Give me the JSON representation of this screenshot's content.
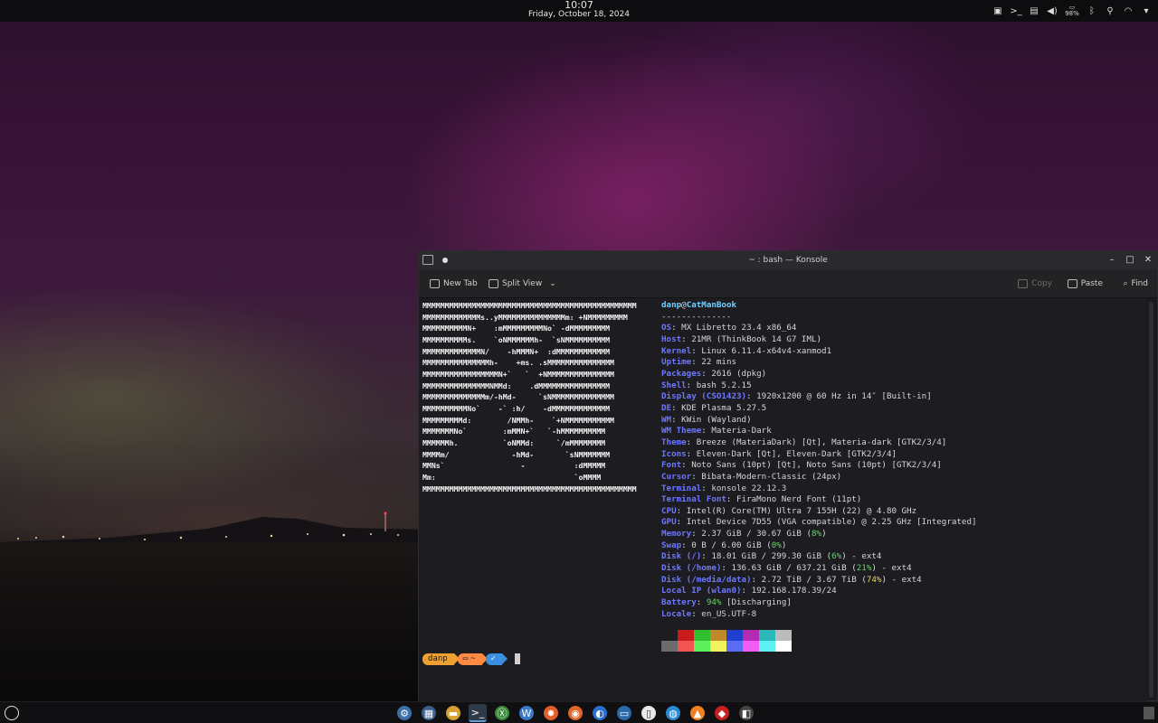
{
  "topbar": {
    "time": "10:07",
    "date": "Friday, October 18, 2024",
    "battery_label": "98%",
    "tray_icons": [
      "package-icon",
      "terminal-icon",
      "clipboard-icon",
      "volume-icon",
      "battery-icon",
      "bluetooth-icon",
      "usb-icon",
      "wifi-icon",
      "menu-arrow-icon"
    ]
  },
  "window": {
    "title": "~ : bash — Konsole"
  },
  "toolbar": {
    "new_tab": "New Tab",
    "split_view": "Split View",
    "copy": "Copy",
    "paste": "Paste",
    "find": "Find"
  },
  "terminal": {
    "ascii": "MMMMMMMMMMMMMMMMMMMMMMMMMMMMMMMMMMMMMMMMMMMMMMMM\nMMMMMMMMMMMMMs..yMMMMMMMMMMMMMMMm: +NMMMMMMMMM\nMMMMMMMMMMN+    :mMMMMMMMMMNo` -dMMMMMMMMM\nMMMMMMMMMMs.    `oNMMMMMMh-  `sNMMMMMMMMMM\nMMMMMMMMMMMMMN/    -hMMMN+  :dMMMMMMMMMMMM\nMMMMMMMMMMMMMMMh-    +ms. .sMMMMMMMMMMMMMMM\nMMMMMMMMMMMMMMMMMN+`   `  +NMMMMMMMMMMMMMMM\nMMMMMMMMMMMMMMMNMMd:    .dMMMMMMMMMMMMMMMM\nMMMMMMMMMMMMMMm/-hMd-     `sNMMMMMMMMMMMMMM\nMMMMMMMMMMNo`    -` :h/    -dMMMMMMMMMMMMM\nMMMMMMMMMd:        /NMMh-    `+NMMMMMMMMMMM\nMMMMMMMNo`        :mMMN+`   `-hMMMMMMMMMM\nMMMMMMh.          `oNMMd:     `/mMMMMMMMM\nMMMMm/              -hMd-       `sNMMMMMMM\nMMNs`                 -           :dMMMMM\nMm:                               `oMMMM\nMMMMMMMMMMMMMMMMMMMMMMMMMMMMMMMMMMMMMMMMMMMMMMMM",
    "user": "danp",
    "at": "@",
    "host": "CatManBook",
    "separator": "--------------",
    "info": [
      {
        "k": "OS",
        "v": "MX Libretto 23.4 x86_64"
      },
      {
        "k": "Host",
        "v": "21MR (ThinkBook 14 G7 IML)"
      },
      {
        "k": "Kernel",
        "v": "Linux 6.11.4-x64v4-xanmod1"
      },
      {
        "k": "Uptime",
        "v": "22 mins"
      },
      {
        "k": "Packages",
        "v": "2616 (dpkg)"
      },
      {
        "k": "Shell",
        "v": "bash 5.2.15"
      },
      {
        "k": "Display (CSO1423)",
        "v": "1920x1200 @ 60 Hz in 14″ [Built-in]"
      },
      {
        "k": "DE",
        "v": "KDE Plasma 5.27.5"
      },
      {
        "k": "WM",
        "v": "KWin (Wayland)"
      },
      {
        "k": "WM Theme",
        "v": "Materia-Dark"
      },
      {
        "k": "Theme",
        "v": "Breeze (MateriaDark) [Qt], Materia-dark [GTK2/3/4]"
      },
      {
        "k": "Icons",
        "v": "Eleven-Dark [Qt], Eleven-Dark [GTK2/3/4]"
      },
      {
        "k": "Font",
        "v": "Noto Sans (10pt) [Qt], Noto Sans (10pt) [GTK2/3/4]"
      },
      {
        "k": "Cursor",
        "v": "Bibata-Modern-Classic (24px)"
      },
      {
        "k": "Terminal",
        "v": "konsole 22.12.3"
      },
      {
        "k": "Terminal Font",
        "v": "FiraMono Nerd Font (11pt)"
      },
      {
        "k": "CPU",
        "v": "Intel(R) Core(TM) Ultra 7 155H (22) @ 4.80 GHz"
      },
      {
        "k": "GPU",
        "v": "Intel Device 7D55 (VGA compatible) @ 2.25 GHz [Integrated]"
      }
    ],
    "memory": {
      "k": "Memory",
      "v": "2.37 GiB / 30.67 GiB (",
      "p": "8%",
      "e": ")"
    },
    "swap": {
      "k": "Swap",
      "v": "0 B / 6.00 GiB (",
      "p": "0%",
      "e": ")"
    },
    "disk1": {
      "k": "Disk (/)",
      "v": "18.01 GiB / 299.30 GiB (",
      "p": "6%",
      "e": ") - ext4"
    },
    "disk2": {
      "k": "Disk (/home)",
      "v": "136.63 GiB / 637.21 GiB (",
      "p": "21%",
      "e": ") - ext4"
    },
    "disk3": {
      "k": "Disk (/media/data)",
      "v": "2.72 TiB / 3.67 TiB (",
      "p": "74%",
      "e": ") - ext4"
    },
    "ip": {
      "k": "Local IP (wlan0)",
      "v": "192.168.178.39/24"
    },
    "battery": {
      "k": "Battery",
      "p": "94%",
      "v": "[Discharging]"
    },
    "locale": {
      "k": "Locale",
      "v": "en_US.UTF-8"
    },
    "palette": [
      "#1d1c20",
      "#c91b1b",
      "#2fbf2f",
      "#c08a2a",
      "#1f3fcf",
      "#b32bb3",
      "#2ab8b8",
      "#bcbcbc",
      "#6b6b6b",
      "#f25353",
      "#5cf05c",
      "#f2f25c",
      "#5c6cf2",
      "#f25cf2",
      "#5cf2f2",
      "#ffffff"
    ],
    "prompt": {
      "user": "danp",
      "dir": "~",
      "status": "✓"
    }
  },
  "taskbar": {
    "apps": [
      "settings-icon",
      "system-monitor-icon",
      "files-icon",
      "konsole-icon",
      "mx-icon",
      "writer-icon",
      "puzzle-icon",
      "firefox-icon",
      "thunderbird-icon",
      "chat-icon",
      "document-icon",
      "browser-icon",
      "vlc-icon",
      "ruby-icon",
      "screenshot-icon"
    ],
    "active": 3
  }
}
